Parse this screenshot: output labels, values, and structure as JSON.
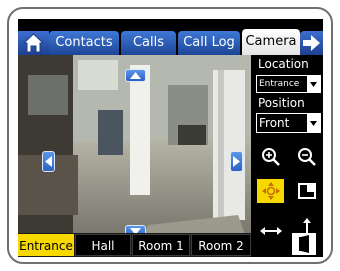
{
  "tabs": {
    "home_icon": "home-icon",
    "items": [
      {
        "label": "Contacts"
      },
      {
        "label": "Calls"
      },
      {
        "label": "Call Log"
      },
      {
        "label": "Camera",
        "active": true
      }
    ],
    "next_icon": "arrow-right-icon"
  },
  "location": {
    "label": "Location",
    "value": "Entrance"
  },
  "position": {
    "label": "Position",
    "value": "Front"
  },
  "tools": [
    "zoom-in-icon",
    "zoom-out-icon",
    "pan-tilt-icon",
    "preset-icon",
    "pan-horizontal-icon",
    "tilt-vertical-icon",
    "door-icon"
  ],
  "camera_tabs": {
    "items": [
      {
        "label": "Entrance",
        "active": true
      },
      {
        "label": "Hall"
      },
      {
        "label": "Room 1"
      },
      {
        "label": "Room 2"
      }
    ]
  },
  "colors": {
    "accent_blue": "#2c62c4",
    "selected_yellow": "#f7d900"
  }
}
